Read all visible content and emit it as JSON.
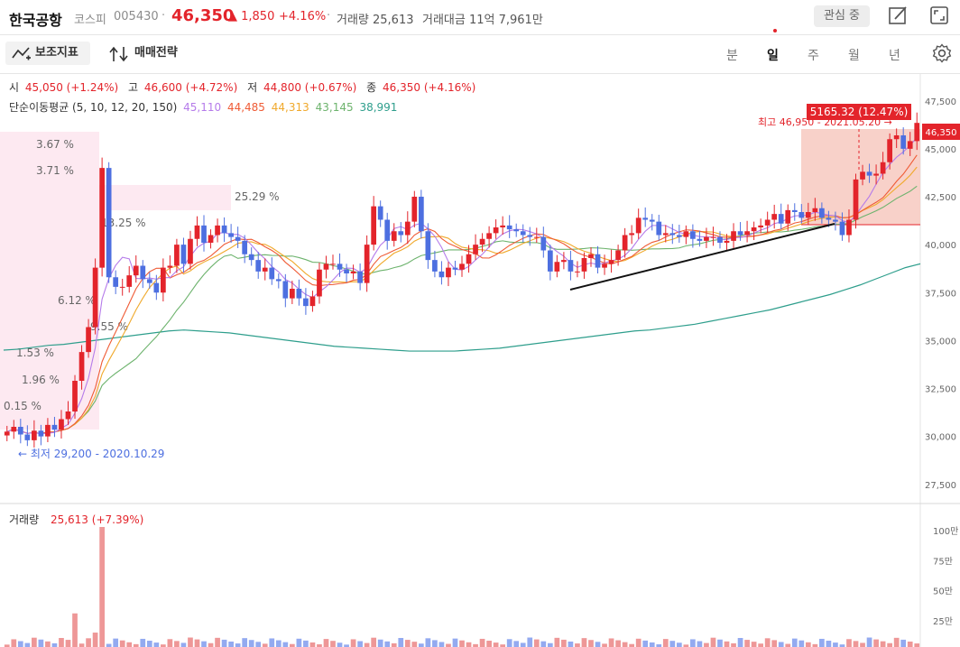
{
  "header": {
    "name": "한국공항",
    "market": "코스피",
    "code": "005430",
    "price": "46,350",
    "change": "▲ 1,850",
    "change_pct": "+4.16%",
    "volume": "거래량 25,613",
    "amount": "거래대금 11억 7,961만",
    "fav_label": "관심 중"
  },
  "toolbar": {
    "indicator_label": "보조지표",
    "strategy_label": "매매전략",
    "periods": [
      "분",
      "일",
      "주",
      "월",
      "년"
    ],
    "active_period": "일"
  },
  "ohlc": {
    "open_label": "시",
    "open": "45,050 (+1.24%)",
    "high_label": "고",
    "high": "46,600 (+4.72%)",
    "low_label": "저",
    "low": "44,800 (+0.67%)",
    "close_label": "종",
    "close": "46,350 (+4.16%)"
  },
  "ma": {
    "label": "단순이동평균 (5, 10, 12, 20, 150)",
    "values": [
      "45,110",
      "44,485",
      "44,313",
      "43,145",
      "38,991"
    ]
  },
  "volume_panel": {
    "label": "거래량",
    "value": "25,613 (+7.39%)"
  },
  "colors": {
    "up": "#e3242b",
    "down": "#4d6fe0",
    "ma5": "#b57bea",
    "ma10": "#ef5b35",
    "ma12": "#f0a92c",
    "ma20": "#6db36d",
    "ma150": "#2e9e8c",
    "zone_pink": "#fde9f1",
    "zone_salmon": "#f7c9bf"
  },
  "chart_data": {
    "type": "candlestick",
    "price_axis_ticks": [
      "47,500",
      "45,000",
      "42,500",
      "40,000",
      "37,500",
      "35,000",
      "32,500",
      "30,000",
      "27,500"
    ],
    "price_ylim": [
      26500,
      48900
    ],
    "current_price_tag": "46,350",
    "volume_axis_ticks": [
      "100만",
      "75만",
      "50만",
      "25만"
    ],
    "volume_ylim": [
      0,
      1000000
    ],
    "high_label": "최고 46,950 - 2021.05.20 →",
    "low_label": "← 최저 29,200 - 2020.10.29",
    "range_tag": "5165.32 (12.47%)",
    "profile_pcts": [
      "3.67 %",
      "3.71 %",
      "25.29 %",
      "13.25 %",
      "6.12 %",
      "9.55 %",
      "1.53 %",
      "1.96 %",
      "0.15 %"
    ],
    "closes": [
      30250,
      30500,
      30100,
      29800,
      30300,
      30000,
      30600,
      30350,
      30900,
      31300,
      32900,
      34400,
      35700,
      38800,
      44000,
      38300,
      37800,
      37800,
      38400,
      38900,
      38200,
      38000,
      37500,
      38800,
      38900,
      40000,
      39000,
      40300,
      41000,
      40100,
      40500,
      41000,
      40600,
      40400,
      40200,
      39500,
      39200,
      38600,
      38800,
      38200,
      38100,
      37200,
      37700,
      37200,
      36800,
      37300,
      38700,
      39000,
      39000,
      38700,
      38500,
      38600,
      38000,
      40000,
      42000,
      41300,
      40200,
      40700,
      40500,
      41200,
      42500,
      40700,
      39200,
      38600,
      38300,
      38800,
      38700,
      39000,
      39500,
      40000,
      40300,
      40600,
      40900,
      41000,
      40800,
      40700,
      40500,
      40400,
      40400,
      39700,
      38600,
      39100,
      39200,
      38600,
      38600,
      39300,
      39500,
      38800,
      39000,
      39200,
      39700,
      40500,
      40600,
      41400,
      41300,
      41200,
      40500,
      40600,
      40500,
      40400,
      40700,
      40300,
      40200,
      40400,
      40400,
      40100,
      40200,
      40700,
      40500,
      40700,
      40900,
      41000,
      41300,
      41600,
      41100,
      41800,
      41700,
      41400,
      41700,
      41900,
      41400,
      41300,
      41200,
      40500,
      41300,
      43400,
      43800,
      43600,
      43700,
      44300,
      45500,
      45700,
      45000,
      45400,
      46350
    ],
    "ma150": [
      34500,
      34550,
      34650,
      34750,
      34800,
      34900,
      35000,
      35100,
      35200,
      35300,
      35400,
      35500,
      35550,
      35500,
      35450,
      35400,
      35300,
      35200,
      35100,
      35000,
      34900,
      34800,
      34700,
      34650,
      34600,
      34550,
      34500,
      34450,
      34450,
      34450,
      34450,
      34500,
      34550,
      34600,
      34700,
      34800,
      34900,
      35000,
      35100,
      35200,
      35300,
      35400,
      35500,
      35550,
      35650,
      35750,
      35850,
      36000,
      36150,
      36300,
      36450,
      36600,
      36800,
      37000,
      37200,
      37400,
      37650,
      37900,
      38200,
      38500,
      38800,
      39000
    ],
    "volume_label_value": "25,613"
  }
}
